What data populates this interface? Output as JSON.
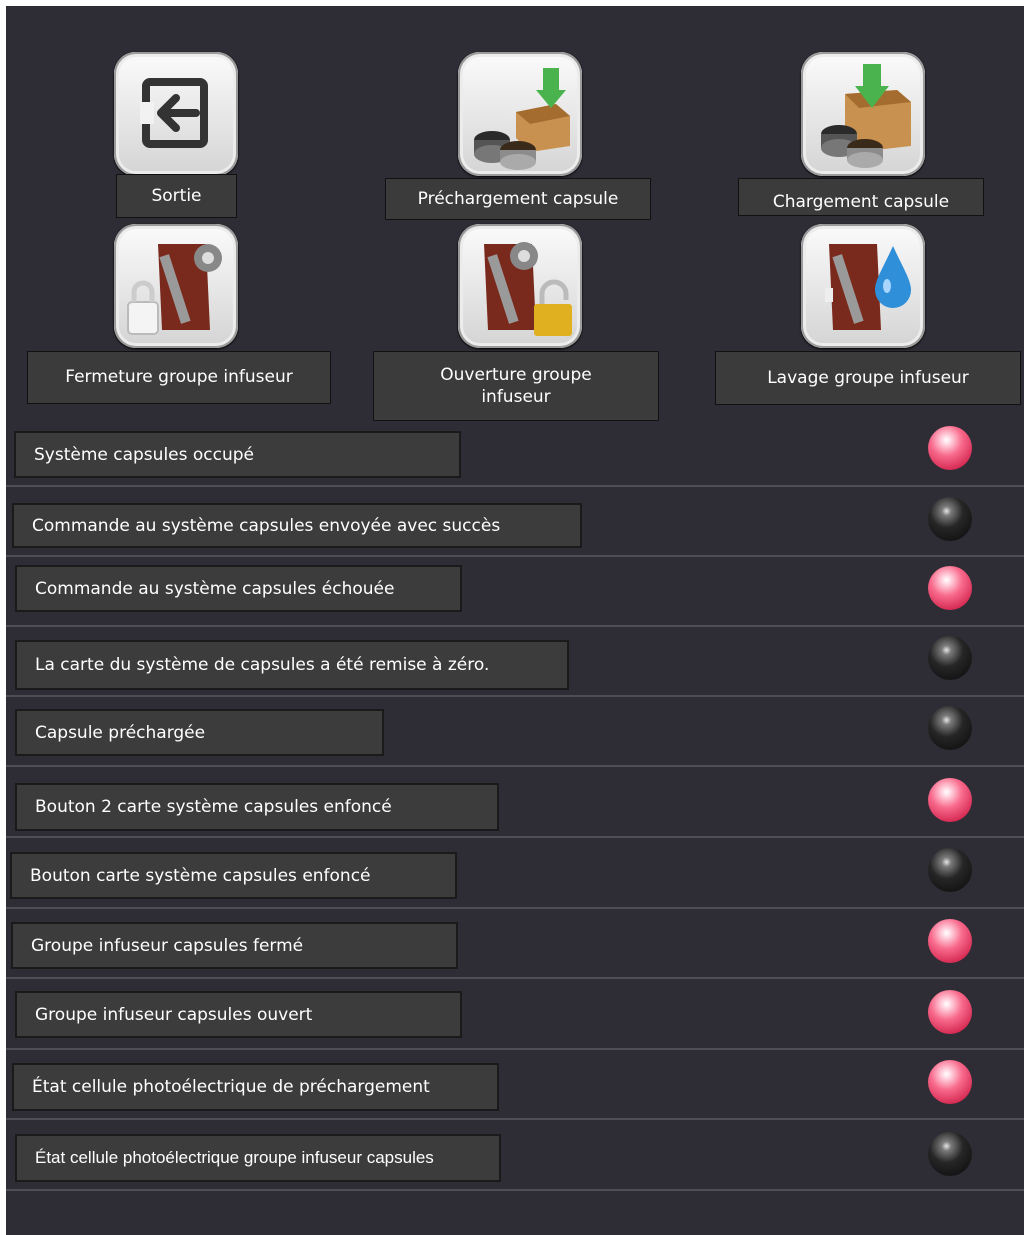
{
  "actions": [
    {
      "label": "Sortie",
      "icon": "exit-icon"
    },
    {
      "label": "Préchargement capsule",
      "icon": "capsule-preload-icon"
    },
    {
      "label": "Chargement capsule",
      "icon": "capsule-load-icon"
    },
    {
      "label": "Fermeture groupe infuseur",
      "icon": "brewer-close-icon"
    },
    {
      "label": "Ouverture groupe infuseur",
      "icon": "brewer-open-icon"
    },
    {
      "label": "Lavage groupe infuseur",
      "icon": "brewer-wash-icon"
    }
  ],
  "status_rows": [
    {
      "label": "Système capsules occupé",
      "state": "red"
    },
    {
      "label": "Commande au système capsules envoyée avec succès",
      "state": "black"
    },
    {
      "label": "Commande au système capsules échouée",
      "state": "red"
    },
    {
      "label": "La carte du système de capsules a été remise à zéro.",
      "state": "black"
    },
    {
      "label": "Capsule préchargée",
      "state": "black"
    },
    {
      "label": "Bouton 2 carte système capsules enfoncé",
      "state": "red"
    },
    {
      "label": "Bouton carte système capsules enfoncé",
      "state": "black"
    },
    {
      "label": "Groupe infuseur capsules fermé",
      "state": "red"
    },
    {
      "label": "Groupe infuseur capsules ouvert",
      "state": "red"
    },
    {
      "label": "État cellule photoélectrique de préchargement",
      "state": "red"
    },
    {
      "label": "État cellule photoélectrique groupe infuseur capsules",
      "state": "black"
    }
  ],
  "colors": {
    "background": "#2e2c35",
    "label_bg": "#3b3b3b",
    "led_on": "#e8385f",
    "led_off": "#111111"
  }
}
